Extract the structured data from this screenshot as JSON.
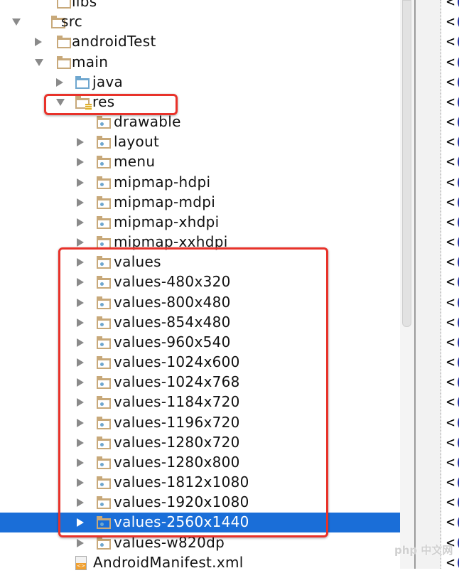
{
  "tree": [
    {
      "label": "libs",
      "depth": 1,
      "arrow": "none",
      "icon": "folder"
    },
    {
      "label": "src",
      "depth": 0,
      "arrow": "down",
      "icon": "folder"
    },
    {
      "label": "androidTest",
      "depth": 1,
      "arrow": "right",
      "icon": "folder"
    },
    {
      "label": "main",
      "depth": 1,
      "arrow": "down",
      "icon": "folder"
    },
    {
      "label": "java",
      "depth": 2,
      "arrow": "right",
      "icon": "folder-blue"
    },
    {
      "label": "res",
      "depth": 2,
      "arrow": "down",
      "icon": "res-folder"
    },
    {
      "label": "drawable",
      "depth": 3,
      "arrow": "none",
      "icon": "res-dir"
    },
    {
      "label": "layout",
      "depth": 3,
      "arrow": "right",
      "icon": "res-dir"
    },
    {
      "label": "menu",
      "depth": 3,
      "arrow": "right",
      "icon": "res-dir"
    },
    {
      "label": "mipmap-hdpi",
      "depth": 3,
      "arrow": "right",
      "icon": "res-dir"
    },
    {
      "label": "mipmap-mdpi",
      "depth": 3,
      "arrow": "right",
      "icon": "res-dir"
    },
    {
      "label": "mipmap-xhdpi",
      "depth": 3,
      "arrow": "right",
      "icon": "res-dir"
    },
    {
      "label": "mipmap-xxhdpi",
      "depth": 3,
      "arrow": "right",
      "icon": "res-dir"
    },
    {
      "label": "values",
      "depth": 3,
      "arrow": "right",
      "icon": "res-dir"
    },
    {
      "label": "values-480x320",
      "depth": 3,
      "arrow": "right",
      "icon": "res-dir"
    },
    {
      "label": "values-800x480",
      "depth": 3,
      "arrow": "right",
      "icon": "res-dir"
    },
    {
      "label": "values-854x480",
      "depth": 3,
      "arrow": "right",
      "icon": "res-dir"
    },
    {
      "label": "values-960x540",
      "depth": 3,
      "arrow": "right",
      "icon": "res-dir"
    },
    {
      "label": "values-1024x600",
      "depth": 3,
      "arrow": "right",
      "icon": "res-dir"
    },
    {
      "label": "values-1024x768",
      "depth": 3,
      "arrow": "right",
      "icon": "res-dir"
    },
    {
      "label": "values-1184x720",
      "depth": 3,
      "arrow": "right",
      "icon": "res-dir"
    },
    {
      "label": "values-1196x720",
      "depth": 3,
      "arrow": "right",
      "icon": "res-dir"
    },
    {
      "label": "values-1280x720",
      "depth": 3,
      "arrow": "right",
      "icon": "res-dir"
    },
    {
      "label": "values-1280x800",
      "depth": 3,
      "arrow": "right",
      "icon": "res-dir"
    },
    {
      "label": "values-1812x1080",
      "depth": 3,
      "arrow": "right",
      "icon": "res-dir"
    },
    {
      "label": "values-1920x1080",
      "depth": 3,
      "arrow": "right",
      "icon": "res-dir"
    },
    {
      "label": "values-2560x1440",
      "depth": 3,
      "arrow": "right",
      "icon": "res-dir",
      "selected": true
    },
    {
      "label": "values-w820dp",
      "depth": 3,
      "arrow": "right",
      "icon": "res-dir"
    },
    {
      "label": "AndroidManifest.xml",
      "depth": 2,
      "arrow": "none",
      "icon": "xml-file"
    }
  ],
  "editor": {
    "line_prefix": "<",
    "line_char": "("
  },
  "watermark": "php 中文网",
  "colors": {
    "selection": "#1a6ed8",
    "highlight_box": "#e8322a",
    "folder": "#c8a97a"
  }
}
